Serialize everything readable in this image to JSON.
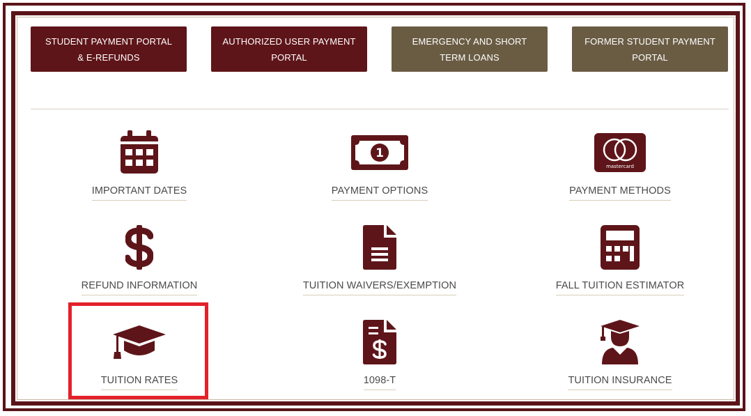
{
  "buttons": [
    {
      "line1": "STUDENT PAYMENT PORTAL",
      "line2": "& E-REFUNDS"
    },
    {
      "line1": "AUTHORIZED USER PAYMENT",
      "line2": "PORTAL"
    },
    {
      "line1": "EMERGENCY AND SHORT",
      "line2": "TERM LOANS"
    },
    {
      "line1": "FORMER STUDENT PAYMENT",
      "line2": "PORTAL"
    }
  ],
  "tiles": [
    {
      "label": "IMPORTANT DATES",
      "icon": "calendar-icon"
    },
    {
      "label": "PAYMENT OPTIONS",
      "icon": "dollar-bill-icon"
    },
    {
      "label": "PAYMENT METHODS",
      "icon": "mastercard-icon",
      "icon_text": "mastercard"
    },
    {
      "label": "REFUND INFORMATION",
      "icon": "dollar-sign-icon"
    },
    {
      "label": "TUITION WAIVERS/EXEMPTION",
      "icon": "document-icon"
    },
    {
      "label": "FALL TUITION ESTIMATOR",
      "icon": "calculator-icon"
    },
    {
      "label": "TUITION RATES",
      "icon": "graduation-cap-icon"
    },
    {
      "label": "1098-T",
      "icon": "invoice-dollar-icon"
    },
    {
      "label": "TUITION INSURANCE",
      "icon": "graduate-icon"
    }
  ],
  "bill_digit": "1",
  "colors": {
    "maroon": "#5e1519",
    "olive": "#6a5c43",
    "highlight": "#e3212b"
  }
}
